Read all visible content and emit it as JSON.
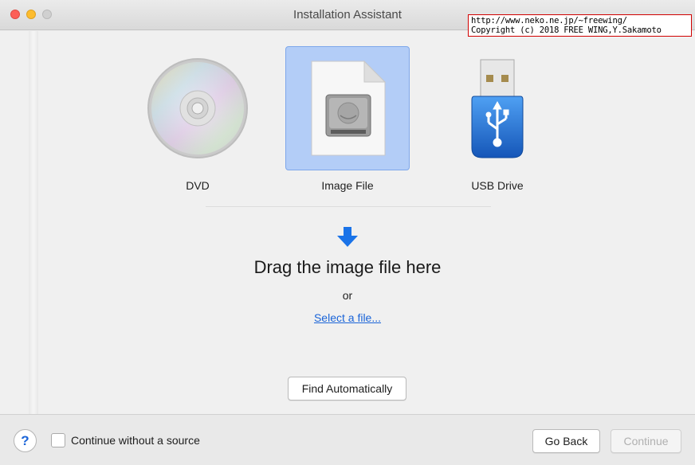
{
  "window": {
    "title": "Installation Assistant"
  },
  "watermark": {
    "line1": "http://www.neko.ne.jp/~freewing/",
    "line2": "Copyright (c) 2018 FREE WING,Y.Sakamoto"
  },
  "sources": [
    {
      "label": "DVD",
      "icon": "dvd-disc-icon",
      "selected": false
    },
    {
      "label": "Image File",
      "icon": "image-file-icon",
      "selected": true
    },
    {
      "label": "USB Drive",
      "icon": "usb-drive-icon",
      "selected": false
    }
  ],
  "drop_zone": {
    "title": "Drag the image file here",
    "or": "or",
    "select_link": "Select a file..."
  },
  "find_button": "Find Automatically",
  "footer": {
    "help": "?",
    "checkbox_label": "Continue without a source",
    "checkbox_checked": false,
    "back_button": "Go Back",
    "continue_button": "Continue"
  },
  "colors": {
    "selection": "#b3cdf7",
    "link": "#1a64d8",
    "arrow": "#1a73e8",
    "usb_body": "#1f73d9"
  }
}
